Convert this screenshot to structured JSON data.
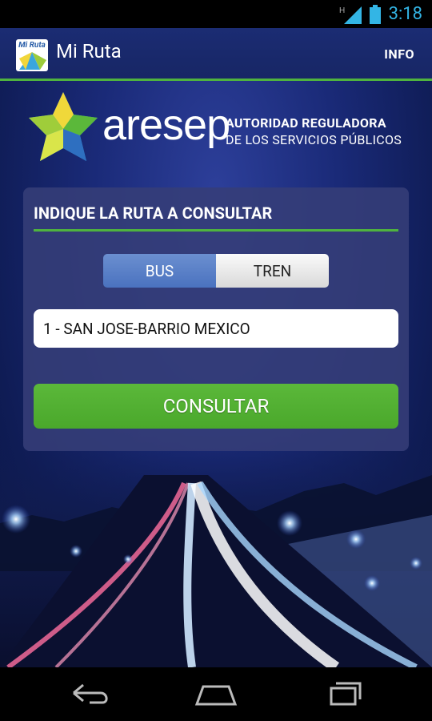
{
  "status_bar": {
    "time": "3:18",
    "signal_label": "H"
  },
  "action_bar": {
    "app_icon_text": "Mi Ruta",
    "title": "Mi Ruta",
    "info_label": "INFO"
  },
  "logo": {
    "wordmark": "aresep",
    "line1": "AUTORIDAD REGULADORA",
    "line2": "DE LOS SERVICIOS PÚBLICOS"
  },
  "card": {
    "title": "INDIQUE LA RUTA A CONSULTAR",
    "tabs": [
      {
        "label": "BUS",
        "selected": true
      },
      {
        "label": "TREN",
        "selected": false
      }
    ],
    "route_value": "1 - SAN JOSE-BARRIO MEXICO",
    "submit_label": "CONSULTAR"
  },
  "colors": {
    "accent_green": "#4fb33f",
    "status_blue": "#33b5e5",
    "bar_blue": "#1b2c73"
  }
}
